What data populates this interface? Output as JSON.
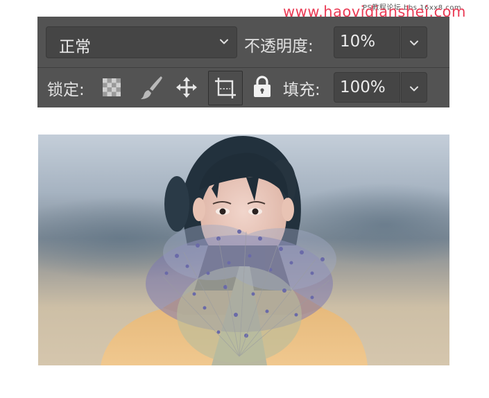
{
  "watermark": {
    "top_text": "PS教程论坛 bbs.16xx8.com",
    "main_text": "www.haovidianshei.com"
  },
  "layers_panel": {
    "blend_mode": "正常",
    "opacity_label": "不透明度:",
    "opacity_value": "10%",
    "lock_label": "锁定:",
    "fill_label": "填充:",
    "fill_value": "100%",
    "lock_icons": [
      "transparency-grid-icon",
      "brush-icon",
      "move-arrows-icon",
      "artboard-crop-icon",
      "padlock-icon"
    ],
    "selected_lock_icon": "artboard-crop-icon"
  },
  "colors": {
    "panel_bg": "#535353",
    "field_bg": "#454545",
    "text": "#e6e6e6",
    "watermark": "#ea3b55"
  },
  "photo": {
    "description_icon": "photo-woman-with-lavender"
  }
}
